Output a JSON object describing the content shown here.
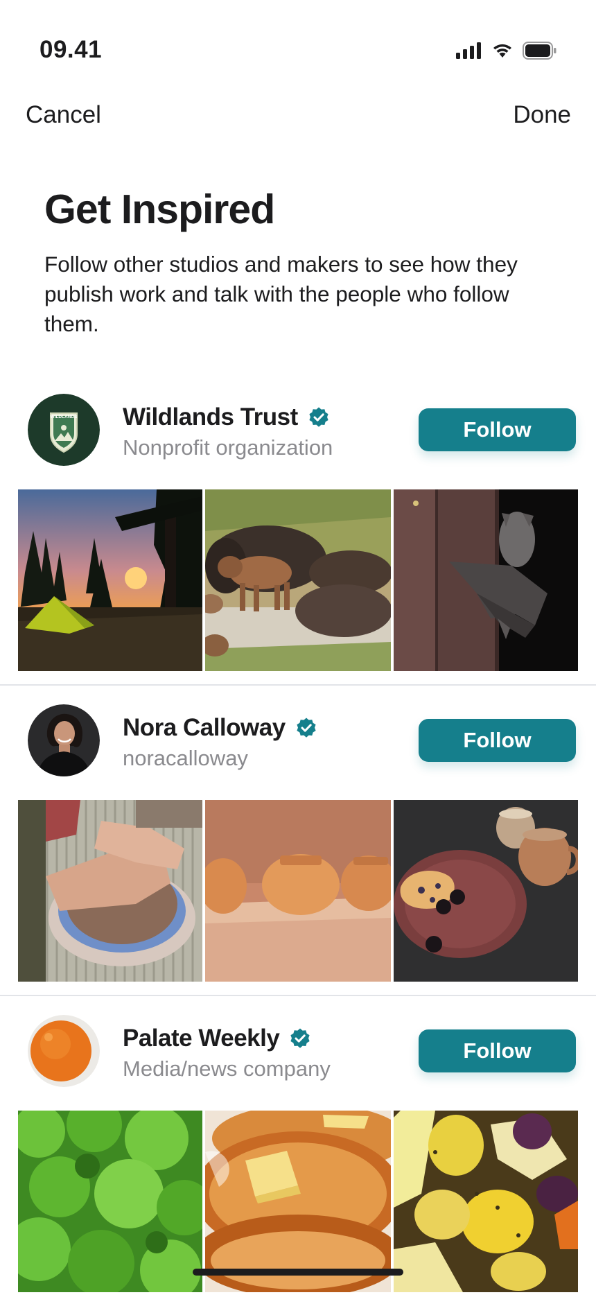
{
  "status_bar": {
    "time": "09.41",
    "icons": [
      "signal-icon",
      "wifi-icon",
      "battery-icon"
    ]
  },
  "nav": {
    "cancel_label": "Cancel",
    "done_label": "Done"
  },
  "header": {
    "title": "Get Inspired",
    "subtitle": "Follow other studios and makers to see how they publish work and talk with the people who follow them."
  },
  "colors": {
    "accent": "#157f8c",
    "secondary_text": "#8a8a8e",
    "divider": "#e2e4e8"
  },
  "accounts": [
    {
      "name": "Wildlands Trust",
      "subtitle": "Nonprofit organization",
      "verified": true,
      "follow_label": "Follow",
      "avatar_text": "WILDLANDS",
      "photos": [
        "campsite-sunset-photo",
        "bison-herd-photo",
        "bat-photo"
      ]
    },
    {
      "name": "Nora Calloway",
      "subtitle": "noracalloway",
      "verified": true,
      "follow_label": "Follow",
      "photos": [
        "pottery-wheel-photo",
        "clay-pots-photo",
        "coffee-scone-photo"
      ]
    },
    {
      "name": "Palate Weekly",
      "subtitle": "Media/news company",
      "verified": true,
      "follow_label": "Follow",
      "photos": [
        "lettuce-photo",
        "pancakes-photo",
        "roasted-vegetables-photo"
      ]
    }
  ]
}
